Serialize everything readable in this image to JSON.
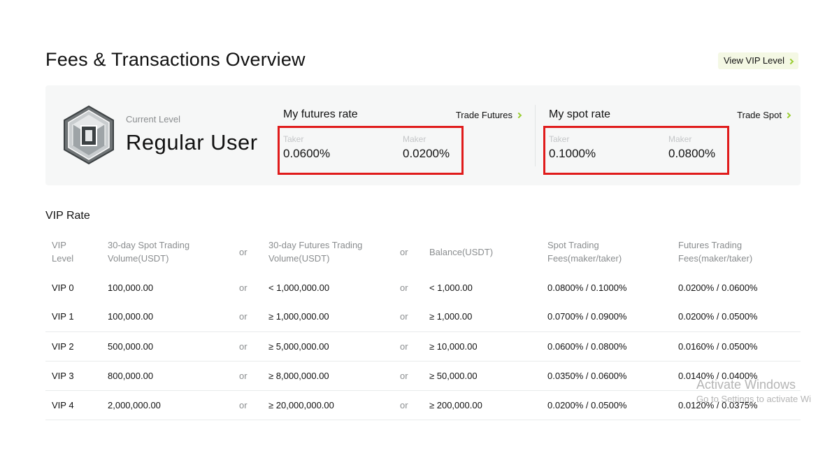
{
  "page": {
    "title": "Fees & Transactions Overview",
    "vip_link_label": "View VIP Level"
  },
  "level": {
    "current_label": "Current Level",
    "name": "Regular User"
  },
  "futures": {
    "title": "My futures rate",
    "action_label": "Trade Futures",
    "taker_label": "Taker",
    "taker_value": "0.0600%",
    "maker_label": "Maker",
    "maker_value": "0.0200%"
  },
  "spot": {
    "title": "My spot rate",
    "action_label": "Trade Spot",
    "taker_label": "Taker",
    "taker_value": "0.1000%",
    "maker_label": "Maker",
    "maker_value": "0.0800%"
  },
  "vip_rate": {
    "title": "VIP Rate",
    "headers": {
      "level_line1": "VIP",
      "level_line2": "Level",
      "spot_vol_line1": "30-day Spot Trading",
      "spot_vol_line2": "Volume(USDT)",
      "or1": "or",
      "futures_vol_line1": "30-day Futures Trading",
      "futures_vol_line2": "Volume(USDT)",
      "or2": "or",
      "balance": "Balance(USDT)",
      "spot_fees_line1": "Spot Trading",
      "spot_fees_line2": "Fees(maker/taker)",
      "futures_fees_line1": "Futures Trading",
      "futures_fees_line2": "Fees(maker/taker)"
    },
    "rows": [
      {
        "level": "VIP 0",
        "spot_vol": "100,000.00",
        "or1": "or",
        "futures_vol": "< 1,000,000.00",
        "or2": "or",
        "balance": "< 1,000.00",
        "spot_fees": "0.0800% / 0.1000%",
        "futures_fees": "0.0200% / 0.0600%"
      },
      {
        "level": "VIP 1",
        "spot_vol": "100,000.00",
        "or1": "or",
        "futures_vol": "≥ 1,000,000.00",
        "or2": "or",
        "balance": "≥ 1,000.00",
        "spot_fees": "0.0700% / 0.0900%",
        "futures_fees": "0.0200% / 0.0500%"
      },
      {
        "level": "VIP 2",
        "spot_vol": "500,000.00",
        "or1": "or",
        "futures_vol": "≥ 5,000,000.00",
        "or2": "or",
        "balance": "≥ 10,000.00",
        "spot_fees": "0.0600% / 0.0800%",
        "futures_fees": "0.0160% / 0.0500%"
      },
      {
        "level": "VIP 3",
        "spot_vol": "800,000.00",
        "or1": "or",
        "futures_vol": "≥ 8,000,000.00",
        "or2": "or",
        "balance": "≥ 50,000.00",
        "spot_fees": "0.0350% / 0.0600%",
        "futures_fees": "0.0140% / 0.0400%"
      },
      {
        "level": "VIP 4",
        "spot_vol": "2,000,000.00",
        "or1": "or",
        "futures_vol": "≥ 20,000,000.00",
        "or2": "or",
        "balance": "≥ 200,000.00",
        "spot_fees": "0.0200% / 0.0500%",
        "futures_fees": "0.0120% / 0.0375%"
      }
    ]
  },
  "watermark": {
    "line1": "Activate Windows",
    "line2": "Go to Settings to activate Windows."
  },
  "colors": {
    "accent": "#9acd32",
    "highlight_box": "#e01b1b",
    "card_bg": "#f6f7f7",
    "muted_text": "#8a8d8f"
  }
}
